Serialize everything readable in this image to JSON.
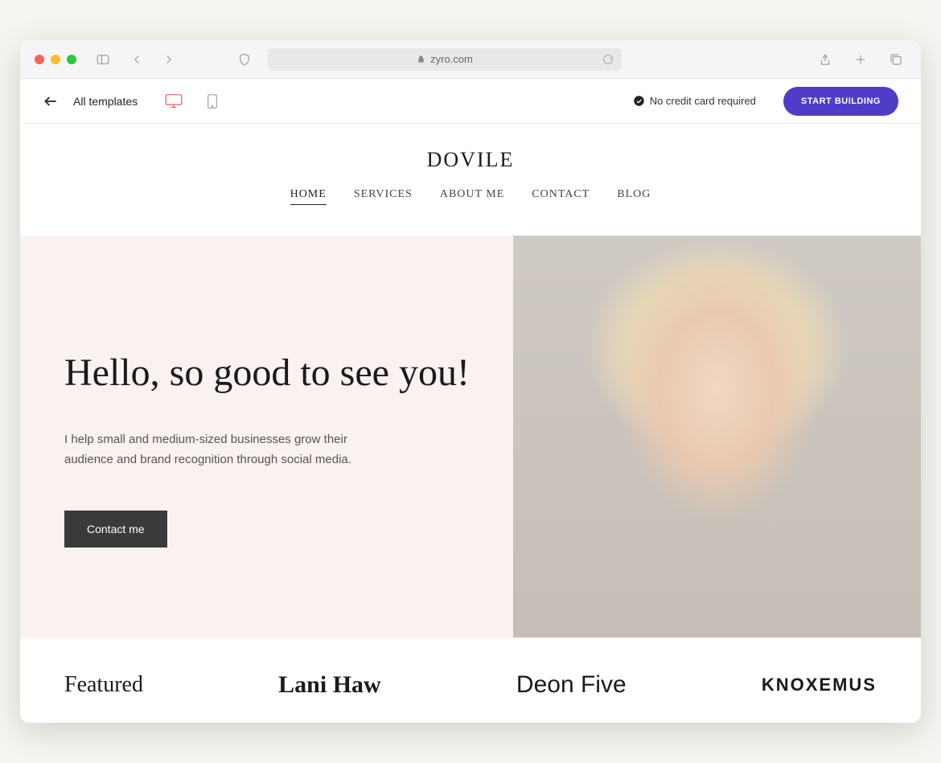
{
  "browser": {
    "url_host": "zyro.com"
  },
  "appbar": {
    "back_label": "All templates",
    "no_cc_text": "No credit card required",
    "start_button": "START BUILDING"
  },
  "site": {
    "brand": "DOVILE",
    "nav": [
      {
        "label": "HOME",
        "active": true
      },
      {
        "label": "SERVICES",
        "active": false
      },
      {
        "label": "ABOUT ME",
        "active": false
      },
      {
        "label": "CONTACT",
        "active": false
      },
      {
        "label": "BLOG",
        "active": false
      }
    ],
    "hero": {
      "title": "Hello, so good to see you!",
      "subtitle": "I help small and medium-sized businesses grow their audience and brand recognition through social media.",
      "cta": "Contact me"
    },
    "featured": {
      "label": "Featured",
      "logos": [
        "Lani Haw",
        "Deon Five",
        "KNOXEMUS"
      ]
    }
  }
}
